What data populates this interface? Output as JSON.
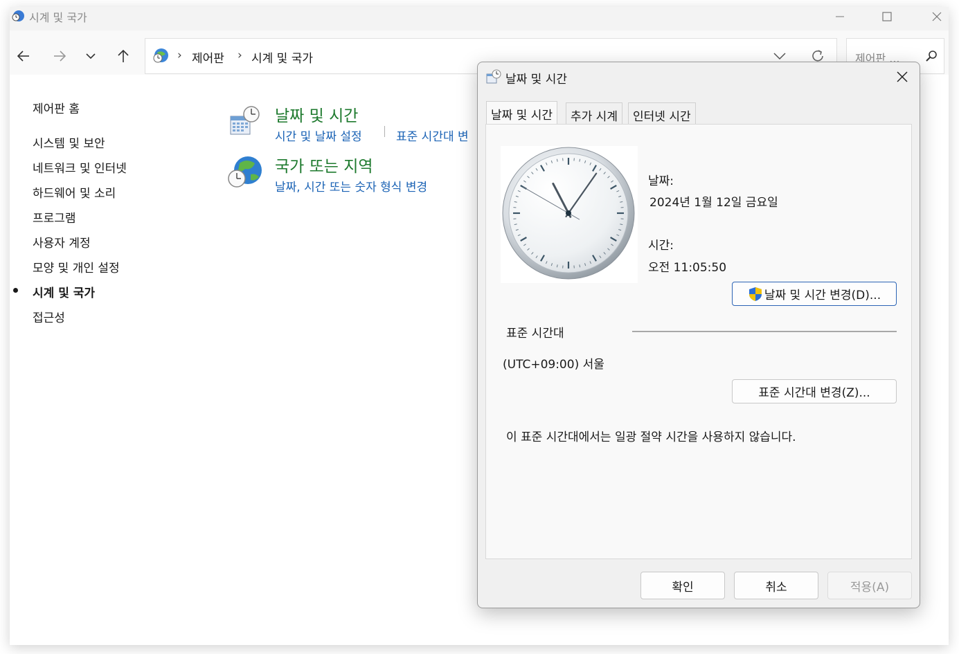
{
  "window": {
    "title": "시계 및 국가"
  },
  "address": {
    "crumbs": [
      "제어판",
      "시계 및 국가"
    ],
    "search_placeholder": "제어판 ..."
  },
  "left_nav": {
    "home": "제어판 홈",
    "items": [
      "시스템 및 보안",
      "네트워크 및 인터넷",
      "하드웨어 및 소리",
      "프로그램",
      "사용자 계정",
      "모양 및 개인 설정",
      "시계 및 국가",
      "접근성"
    ],
    "active_index": 6
  },
  "categories": [
    {
      "title": "날짜 및 시간",
      "links": [
        "시간 및 날짜 설정",
        "표준 시간대 변"
      ],
      "icon": "calendar-clock-icon"
    },
    {
      "title": "국가 또는 지역",
      "links": [
        "날짜, 시간 또는 숫자 형식 변경"
      ],
      "icon": "globe-clock-icon"
    }
  ],
  "dialog": {
    "title": "날짜 및 시간",
    "tabs": [
      "날짜 및 시간",
      "추가 시계",
      "인터넷 시간"
    ],
    "active_tab": 0,
    "date_label": "날짜:",
    "date_value": "2024년 1월 12일 금요일",
    "time_label": "시간:",
    "time_value": "오전 11:05:50",
    "change_datetime_button": "날짜 및 시간 변경(D)...",
    "timezone_heading": "표준 시간대",
    "timezone_value": "(UTC+09:00) 서울",
    "change_timezone_button": "표준 시간대 변경(Z)...",
    "dst_note": "이 표준 시간대에서는 일광 절약 시간을 사용하지 않습니다.",
    "ok_button": "확인",
    "cancel_button": "취소",
    "apply_button": "적용(A)",
    "clock": {
      "hour": 11,
      "minute": 5,
      "second": 50
    }
  },
  "colors": {
    "category_title": "#1e7a2e",
    "link": "#1b63b5",
    "shield_blue": "#2b6fd6",
    "shield_yellow": "#f2c20d"
  }
}
